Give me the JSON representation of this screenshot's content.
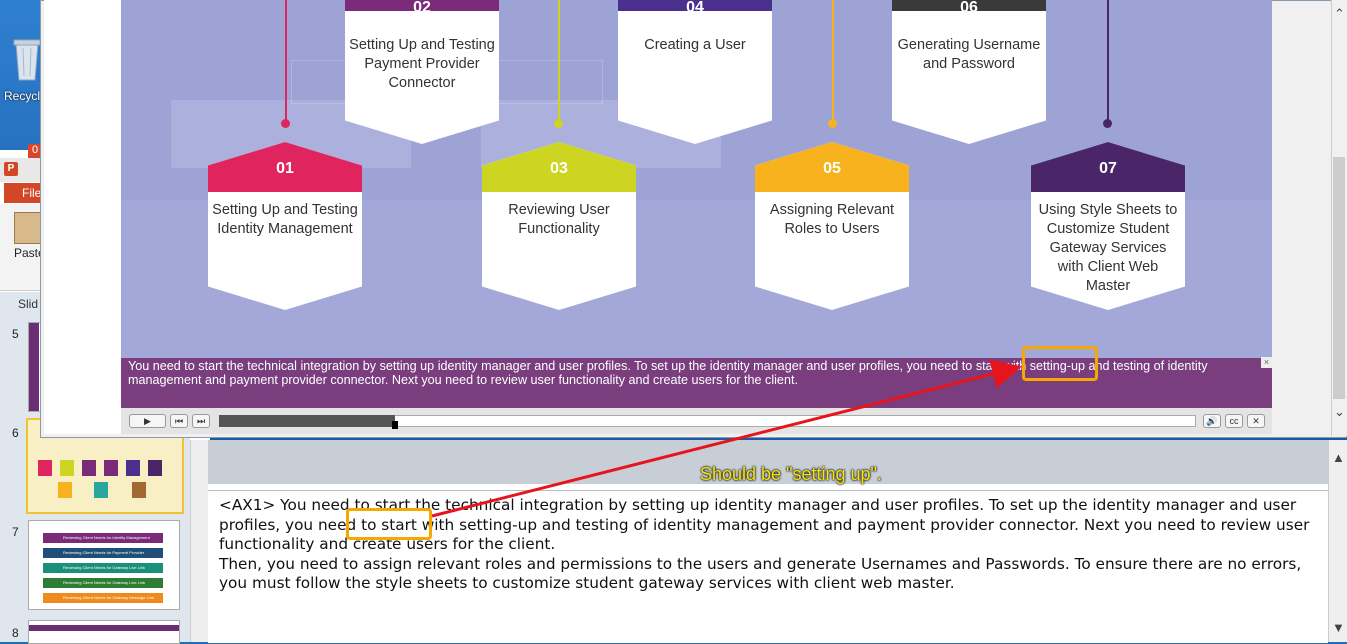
{
  "desktop": {
    "recycle_label": "Recycl"
  },
  "ppt": {
    "file_tab": "File",
    "paste_label": "Paste",
    "slides_tab": "Slid",
    "red_badge": "0",
    "slide_numbers": [
      "5",
      "6",
      "7",
      "8"
    ],
    "thumb7_rows": [
      "Reviewing Client Needs for Identity Management",
      "Reviewing Client Needs for Payment Provider",
      "Reviewing Client Needs for Gateway Live Link",
      "Reviewing Client Needs for Gateway Live Link",
      "Reviewing Client Needs for Gateway Message Link"
    ]
  },
  "stage": {
    "steps": [
      {
        "num": "01",
        "title": "Setting Up and Testing Identity Management",
        "color": "#e0245e"
      },
      {
        "num": "02",
        "title": "Setting Up and Testing Payment Provider Connector",
        "color": "#7b2b7a"
      },
      {
        "num": "03",
        "title": "Reviewing User Functionality",
        "color": "#cdd522"
      },
      {
        "num": "04",
        "title": "Creating a User",
        "color": "#4b2f8c"
      },
      {
        "num": "05",
        "title": "Assigning Relevant Roles to Users",
        "color": "#f7b21d"
      },
      {
        "num": "06",
        "title": "Generating Username and Password",
        "color": "#3a3a3a"
      },
      {
        "num": "07",
        "title": "Using Style Sheets to Customize Student Gateway Services with Client Web Master",
        "color": "#4a2668"
      }
    ]
  },
  "caption": {
    "text": "You need to start the technical integration by setting up identity manager and user profiles. To set up the identity manager and user profiles, you need to start with setting-up and testing of identity management and payment provider connector. Next you need to review user functionality and create users for the client.",
    "close": "×"
  },
  "player": {
    "progress_fraction": 0.18,
    "buttons": {
      "play": "▶",
      "prev": "⏮",
      "next": "⏭",
      "volume": "🔊",
      "cc": "cc",
      "close": "✕"
    }
  },
  "annotation": {
    "label": "Should be \"setting up\".",
    "color": "#f5e50b"
  },
  "notes": {
    "paragraph1": "<AX1> You need to start the technical integration by setting up identity manager and user profiles. To set up the identity manager and user profiles, you need to start with setting-up and testing of identity management and payment provider connector. Next you need to review user functionality and create users for the client.",
    "paragraph2": "Then, you need to assign relevant roles and permissions to the users and generate Usernames and Passwords. To ensure there are no errors, you must follow the style sheets to customize student gateway services with client web master."
  }
}
